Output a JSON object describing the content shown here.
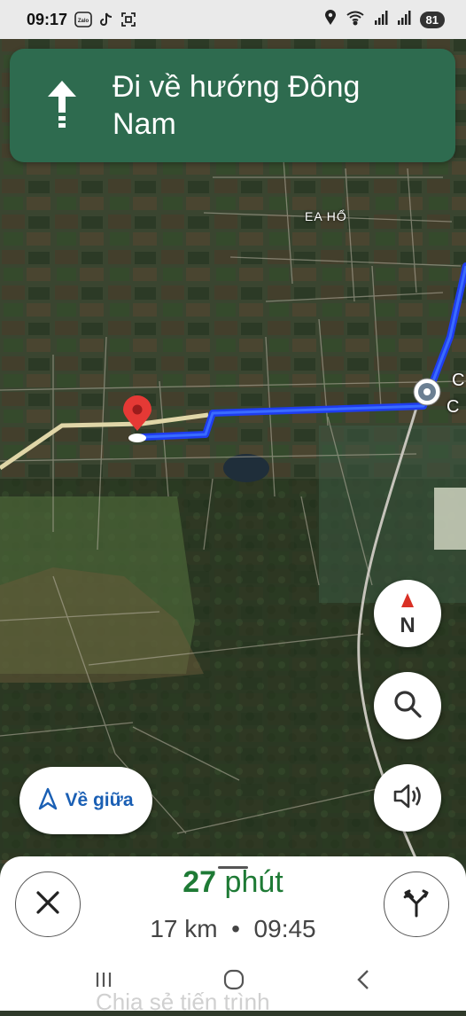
{
  "status_bar": {
    "time": "09:17",
    "left_icons": [
      "zalo-icon",
      "tiktok-icon",
      "scan-icon"
    ],
    "app_badge": "Zalo",
    "right_icons": [
      "location-icon",
      "wifi-icon",
      "signal-icon",
      "signal-icon"
    ],
    "battery": "81"
  },
  "nav_banner": {
    "icon": "arrow-up-icon",
    "instruction": "Đi về hướng Đông Nam"
  },
  "map": {
    "place_labels": [
      "EA HỔ",
      "C",
      "C"
    ],
    "route_color": "#1f3df0",
    "road_color": "#e0d6a8"
  },
  "controls": {
    "compass_label": "N",
    "recenter_label": "Về giữa",
    "search": "search-icon",
    "sound": "volume-icon"
  },
  "eta": {
    "duration_value": "27",
    "duration_unit": "phút",
    "distance": "17 km",
    "separator": "•",
    "arrival": "09:45",
    "accent_color": "#1e7a35"
  },
  "bottom_sheet": {
    "close": "close-icon",
    "alternates": "route-fork-icon",
    "peek_text": "Chia sẻ tiến trình"
  },
  "system_nav": [
    "recents-icon",
    "home-icon",
    "back-icon"
  ]
}
